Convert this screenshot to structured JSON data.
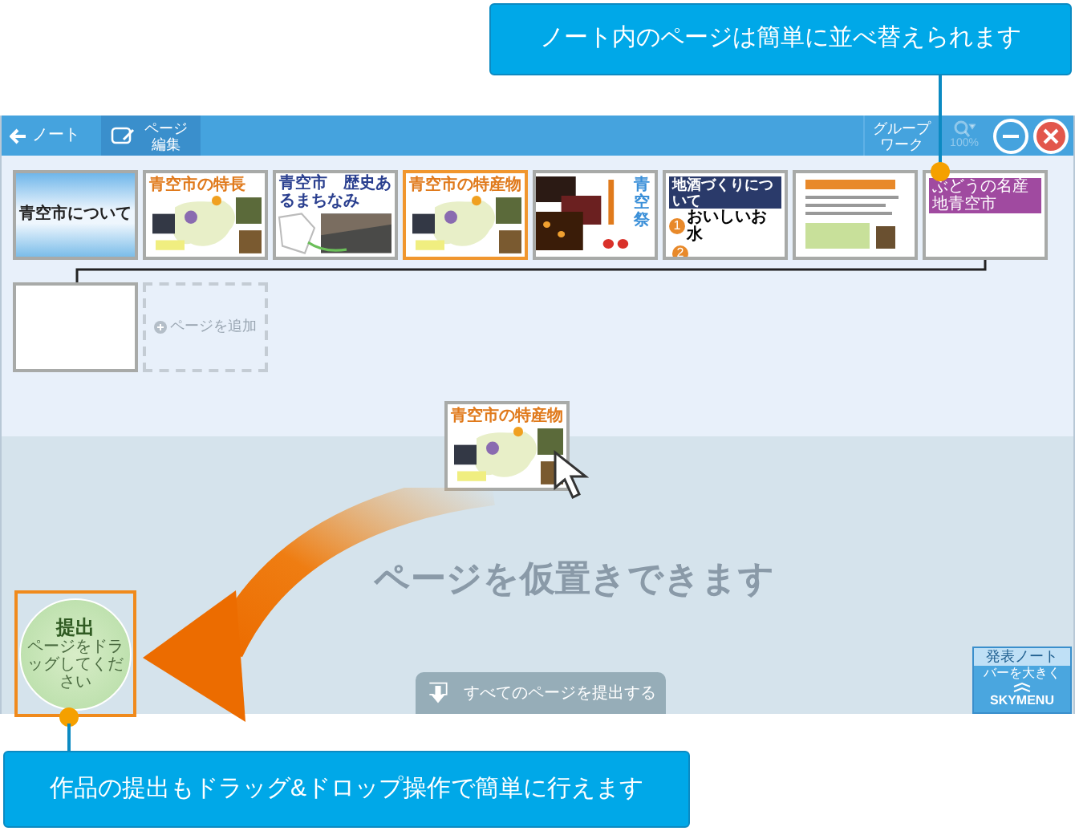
{
  "top_callout": {
    "text": "ノート内のページは簡単に並べ替えられます"
  },
  "toolbar": {
    "back": "ノート",
    "page_edit": {
      "label": "ページ編集",
      "selected": true
    },
    "group_work": "グループワーク",
    "zoom": {
      "label": "100%",
      "disabled": true
    }
  },
  "pages": [
    {
      "kind": "sky",
      "title": "青空市について",
      "selected": false
    },
    {
      "kind": "map",
      "title": "青空市の特長",
      "selected": false
    },
    {
      "kind": "photo",
      "title": "青空市　歴史あるまちなみ",
      "selected": false
    },
    {
      "kind": "map",
      "title": "青空市の特産物",
      "selected": true
    },
    {
      "kind": "festival",
      "title": "青空祭",
      "selected": false
    },
    {
      "kind": "list",
      "title": "地酒づくりについて",
      "heading": "おいしいお水",
      "badges": [
        "1",
        "2"
      ],
      "selected": false
    },
    {
      "kind": "notes",
      "selected": false
    },
    {
      "kind": "banner",
      "title": "ぶどうの名産地青空市",
      "selected": false
    },
    {
      "kind": "blank",
      "selected": false
    }
  ],
  "add_page": "ページを追加",
  "floating_page": {
    "title": "青空市の特産物"
  },
  "drop_hint": "ページを仮置きできます",
  "submit_zone": {
    "title": "提出",
    "hint": "ページをドラッグしてください"
  },
  "submit_all_button": "すべてのページを提出する",
  "skymenu": {
    "title": "発表ノート",
    "toggle": "バーを大きく",
    "brand": "SKYMENU"
  },
  "bottom_callout": {
    "text": "作品の提出もドラッグ&ドロップ操作で簡単に行えます"
  }
}
